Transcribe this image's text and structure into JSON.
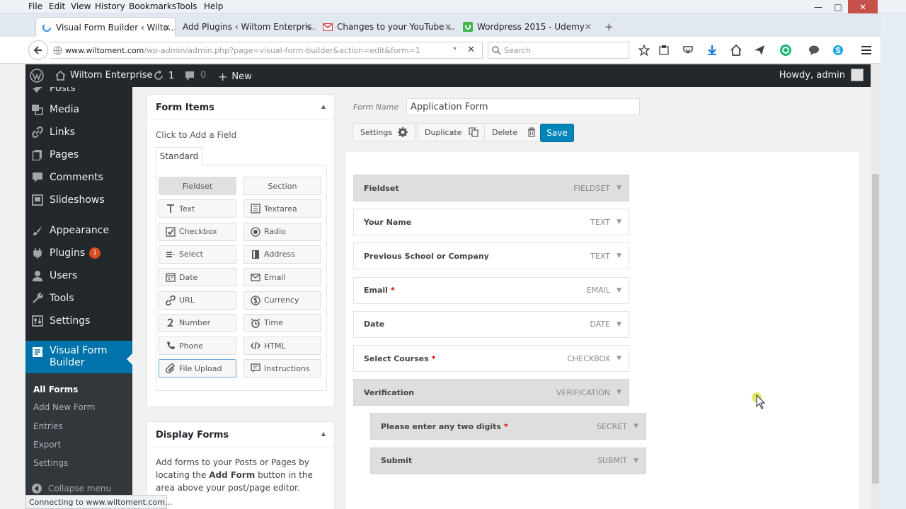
{
  "menu": [
    "File",
    "Edit",
    "View",
    "History",
    "Bookmarks",
    "Tools",
    "Help"
  ],
  "tabs": [
    {
      "label": "Visual Form Builder ‹ Wilto...",
      "active": true
    },
    {
      "label": "Add Plugins ‹ Wiltom Enterpris...",
      "active": false
    },
    {
      "label": "Changes to your YouTube ...",
      "active": false
    },
    {
      "label": "Wordpress 2015 - Udemy",
      "active": false
    }
  ],
  "new_tab": "+",
  "url": {
    "domain": "www.wiltoment.com",
    "path": "/wp-admin/admin.php?page=visual-form-builder&action=edit&form=1"
  },
  "search_placeholder": "Search",
  "adminbar": {
    "site": "Wiltom Enterprise",
    "updates": "1",
    "comments": "0",
    "new": "New",
    "howdy": "Howdy, admin"
  },
  "sidebar": {
    "items": [
      {
        "label": "Posts",
        "icon": "pin-icon"
      },
      {
        "label": "Media",
        "icon": "media-icon"
      },
      {
        "label": "Links",
        "icon": "link-icon"
      },
      {
        "label": "Pages",
        "icon": "pages-icon"
      },
      {
        "label": "Comments",
        "icon": "comment-icon"
      },
      {
        "label": "Slideshows",
        "icon": "slideshow-icon"
      },
      {
        "label": "Appearance",
        "icon": "brush-icon"
      },
      {
        "label": "Plugins",
        "icon": "plugin-icon",
        "badge": "1"
      },
      {
        "label": "Users",
        "icon": "user-icon"
      },
      {
        "label": "Tools",
        "icon": "wrench-icon"
      },
      {
        "label": "Settings",
        "icon": "settings-icon"
      }
    ],
    "active": {
      "label": "Visual Form Builder"
    },
    "submenu": [
      "All Forms",
      "Add New Form",
      "Entries",
      "Export",
      "Settings"
    ],
    "collapse": "Collapse menu"
  },
  "form_items": {
    "title": "Form Items",
    "hint": "Click to Add a Field",
    "tab": "Standard",
    "buttons": [
      "Fieldset",
      "Section",
      "Text",
      "Textarea",
      "Checkbox",
      "Radio",
      "Select",
      "Address",
      "Date",
      "Email",
      "URL",
      "Currency",
      "Number",
      "Time",
      "Phone",
      "HTML",
      "File Upload",
      "Instructions"
    ]
  },
  "display_forms": {
    "title": "Display Forms",
    "text_1": "Add forms to your Posts or Pages by locating the ",
    "text_bold": "Add Form",
    "text_2": " button in the area above your post/page editor."
  },
  "editor": {
    "form_name_label": "Form Name",
    "form_name_value": "Application Form",
    "settings": "Settings",
    "duplicate": "Duplicate",
    "delete": "Delete",
    "save": "Save",
    "fields": [
      {
        "label": "Fieldset",
        "type": "FIELDSET",
        "required": false
      },
      {
        "label": "Your Name",
        "type": "TEXT",
        "required": false
      },
      {
        "label": "Previous School or Company",
        "type": "TEXT",
        "required": false
      },
      {
        "label": "Email",
        "type": "EMAIL",
        "required": true
      },
      {
        "label": "Date",
        "type": "DATE",
        "required": false
      },
      {
        "label": "Select Courses",
        "type": "CHECKBOX",
        "required": true
      },
      {
        "label": "Verification",
        "type": "VERIFICATION",
        "required": false
      },
      {
        "label": "Please enter any two digits",
        "type": "SECRET",
        "required": true
      },
      {
        "label": "Submit",
        "type": "SUBMIT",
        "required": false
      }
    ]
  },
  "status_text": "Connecting to www.wiltoment.com...",
  "colors": {
    "wp_dark": "#23282d",
    "wp_blue": "#0073aa",
    "save_blue": "#0085ba",
    "badge": "#d54e21"
  }
}
